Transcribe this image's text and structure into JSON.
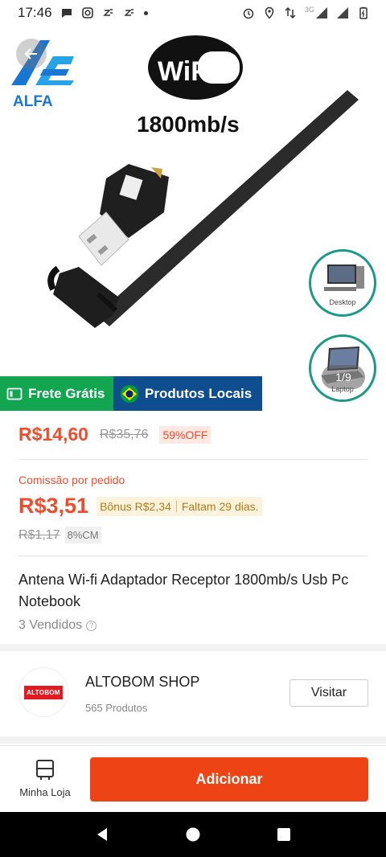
{
  "status_bar": {
    "time": "17:46",
    "network": "3G"
  },
  "product_image": {
    "brand_logo": "ALFA",
    "wifi_logo": "WiFi",
    "speed_text": "1800mb/s",
    "pager": "1/9",
    "thumbs": [
      {
        "label": "Desktop"
      },
      {
        "label": "Laptop"
      }
    ]
  },
  "badges": {
    "free_shipping": "Frete Grátis",
    "local_products": "Produtos Locais"
  },
  "price": {
    "current": "R$14,60",
    "original": "R$35,76",
    "discount": "59%OFF"
  },
  "commission": {
    "label": "Comissão por pedido",
    "value": "R$3,51",
    "bonus": "Bônus R$2,34",
    "remaining": "Faltam 29 dias.",
    "original": "R$1,17",
    "rate": "8%CM"
  },
  "product": {
    "title": "Antena Wi-fi Adaptador Receptor 1800mb/s Usb Pc Notebook",
    "sold": "3 Vendidos"
  },
  "shop": {
    "logo_text": "ALTOBOM",
    "name": "ALTOBOM SHOP",
    "products": "565 Produtos",
    "visit_label": "Visitar"
  },
  "action_bar": {
    "my_store": "Minha Loja",
    "add": "Adicionar"
  },
  "colors": {
    "accent": "#ee4d2d",
    "add_button": "#ee4415",
    "free_shipping_bg": "#13a650",
    "local_products_bg": "#0e4e8f"
  }
}
